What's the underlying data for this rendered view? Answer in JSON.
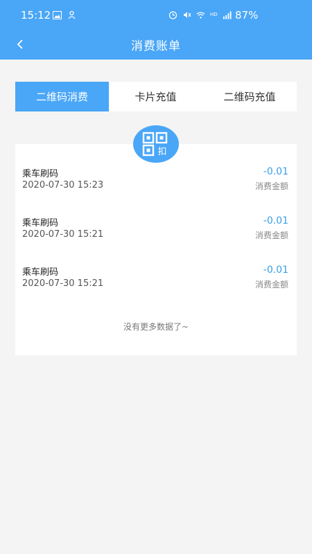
{
  "status_bar": {
    "time": "15:12",
    "battery": "87%",
    "network_label": "HD",
    "left_icons": [
      "image-icon",
      "notification-icon"
    ],
    "right_icons": [
      "alarm-icon",
      "mute-icon",
      "wifi-icon",
      "signal-icon"
    ]
  },
  "header": {
    "title": "消费账单",
    "back_icon": "chevron-left-icon",
    "bg_color": "#4aa6f7"
  },
  "tabs": [
    {
      "label": "二维码消费",
      "active": true
    },
    {
      "label": "卡片充值",
      "active": false
    },
    {
      "label": "二维码充值",
      "active": false
    }
  ],
  "badge": {
    "label": "扣",
    "icon": "qrcode-icon"
  },
  "records": [
    {
      "name": "乘车刷码",
      "time": "2020-07-30 15:23",
      "amount": "-0.01",
      "label": "消费金额"
    },
    {
      "name": "乘车刷码",
      "time": "2020-07-30 15:21",
      "amount": "-0.01",
      "label": "消费金额"
    },
    {
      "name": "乘车刷码",
      "time": "2020-07-30 15:21",
      "amount": "-0.01",
      "label": "消费金额"
    }
  ],
  "footer": {
    "no_more": "没有更多数据了~"
  },
  "colors": {
    "accent": "#4aa6f7",
    "amount": "#3a9ee8",
    "background": "#f4f4f4"
  }
}
